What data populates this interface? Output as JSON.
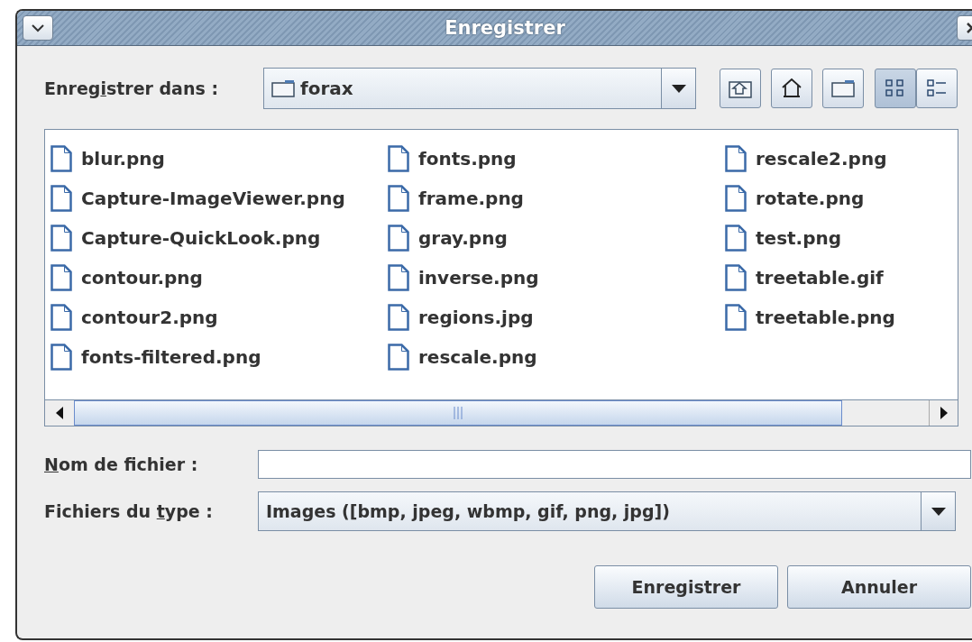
{
  "window": {
    "title": "Enregistrer"
  },
  "save_in": {
    "label": {
      "before": "Enreg",
      "key": "i",
      "after": "strer dans :"
    },
    "value": "forax"
  },
  "view_buttons": [
    {
      "kind": "list",
      "selected": true
    },
    {
      "kind": "details",
      "selected": false
    }
  ],
  "files": [
    {
      "name": "blur.png"
    },
    {
      "name": "Capture-ImageViewer.png"
    },
    {
      "name": "Capture-QuickLook.png"
    },
    {
      "name": "contour.png"
    },
    {
      "name": "contour2.png"
    },
    {
      "name": "fonts-filtered.png"
    },
    {
      "name": "fonts.png"
    },
    {
      "name": "frame.png"
    },
    {
      "name": "gray.png"
    },
    {
      "name": "inverse.png"
    },
    {
      "name": "regions.jpg"
    },
    {
      "name": "rescale.png"
    },
    {
      "name": "rescale2.png"
    },
    {
      "name": "rotate.png"
    },
    {
      "name": "test.png"
    },
    {
      "name": "treetable.gif"
    },
    {
      "name": "treetable.png"
    }
  ],
  "file_name": {
    "label": {
      "key": "N",
      "after": "om de fichier :"
    }
  },
  "file_type": {
    "label": {
      "before": "Fichiers du ",
      "key": "t",
      "after": "ype :"
    },
    "value": "Images ([bmp, jpeg, wbmp, gif, png, jpg])"
  },
  "buttons": [
    "Enregistrer",
    "Annuler"
  ]
}
